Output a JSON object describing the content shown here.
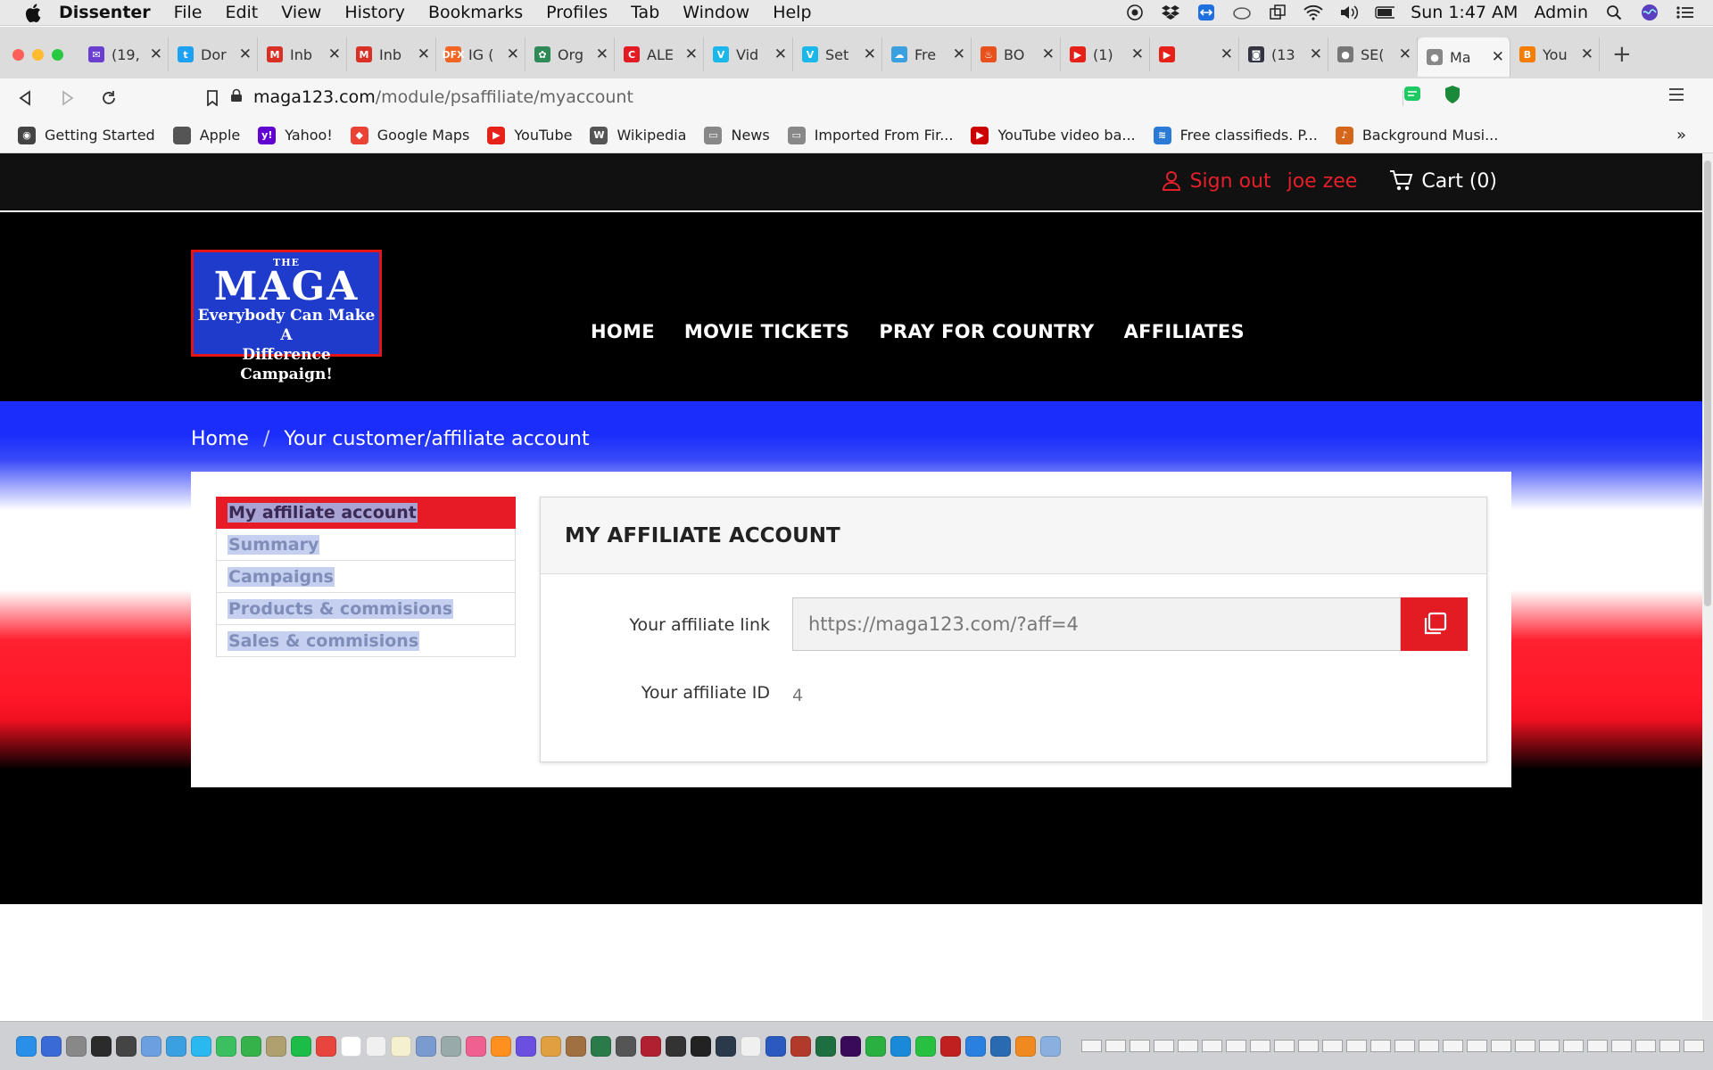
{
  "menubar": {
    "app": "Dissenter",
    "items": [
      "File",
      "Edit",
      "View",
      "History",
      "Bookmarks",
      "Profiles",
      "Tab",
      "Window",
      "Help"
    ],
    "clock": "Sun 1:47 AM",
    "user": "Admin"
  },
  "tabs": [
    {
      "label": "(19,",
      "color": "#6a3fcf",
      "glyph": "✉"
    },
    {
      "label": "Dor",
      "color": "#1da1f2",
      "glyph": "t"
    },
    {
      "label": "Inb",
      "color": "#d93025",
      "glyph": "M"
    },
    {
      "label": "Inb",
      "color": "#d93025",
      "glyph": "M"
    },
    {
      "label": "IG (",
      "color": "#f26522",
      "glyph": "DFX"
    },
    {
      "label": "Org",
      "color": "#2e8b57",
      "glyph": "✿"
    },
    {
      "label": "ALE",
      "color": "#e31b23",
      "glyph": "C"
    },
    {
      "label": "Vid",
      "color": "#1ab7ea",
      "glyph": "V"
    },
    {
      "label": "Set",
      "color": "#1ab7ea",
      "glyph": "V"
    },
    {
      "label": "Fre",
      "color": "#3aa0e0",
      "glyph": "☁"
    },
    {
      "label": "BO",
      "color": "#e8501c",
      "glyph": "♨"
    },
    {
      "label": "(1)",
      "color": "#e62117",
      "glyph": "▶"
    },
    {
      "label": "",
      "color": "#e62117",
      "glyph": "▶"
    },
    {
      "label": "(13",
      "color": "#333344",
      "glyph": "◙"
    },
    {
      "label": "SE(",
      "color": "#777777",
      "glyph": "●"
    },
    {
      "label": "Ma",
      "color": "#888888",
      "glyph": "●"
    },
    {
      "label": "You",
      "color": "#f57d00",
      "glyph": "B"
    }
  ],
  "address": {
    "host": "maga123.com",
    "path": "/module/psaffiliate/myaccount"
  },
  "bookmarks": [
    {
      "label": "Getting Started",
      "color": "#444",
      "glyph": "◉"
    },
    {
      "label": "Apple",
      "color": "#555",
      "glyph": ""
    },
    {
      "label": "Yahoo!",
      "color": "#6001d2",
      "glyph": "y!"
    },
    {
      "label": "Google Maps",
      "color": "#ea4335",
      "glyph": "◆"
    },
    {
      "label": "YouTube",
      "color": "#e62117",
      "glyph": "▶"
    },
    {
      "label": "Wikipedia",
      "color": "#555",
      "glyph": "W"
    },
    {
      "label": "News",
      "color": "#888",
      "glyph": "▭"
    },
    {
      "label": "Imported From Fir...",
      "color": "#888",
      "glyph": "▭"
    },
    {
      "label": "YouTube video ba...",
      "color": "#c00",
      "glyph": "▶"
    },
    {
      "label": "Free classifieds. P...",
      "color": "#2a7ad6",
      "glyph": "≋"
    },
    {
      "label": "Background Musi...",
      "color": "#d5661a",
      "glyph": "♪"
    }
  ],
  "site": {
    "sign_out": "Sign out",
    "user_name": "joe zee",
    "cart": "Cart (0)",
    "logo": {
      "the": "THE",
      "maga": "MAGA",
      "line1": "Everybody Can Make A",
      "line2": "Difference Campaign!"
    },
    "nav": [
      "HOME",
      "MOVIE TICKETS",
      "PRAY FOR COUNTRY",
      "AFFILIATES"
    ],
    "breadcrumb": {
      "home": "Home",
      "current": "Your customer/affiliate account"
    },
    "sidebar": [
      "My affiliate account",
      "Summary",
      "Campaigns",
      "Products & commisions",
      "Sales & commisions"
    ],
    "card_title": "MY AFFILIATE ACCOUNT",
    "affiliate_link_label": "Your affiliate link",
    "affiliate_link_value": "https://maga123.com/?aff=4",
    "affiliate_id_label": "Your affiliate ID",
    "affiliate_id_value": "4"
  },
  "colors": {
    "accent_red": "#e31b23",
    "flag_blue": "#1a2dfa",
    "logo_blue": "#1f3bcc"
  }
}
